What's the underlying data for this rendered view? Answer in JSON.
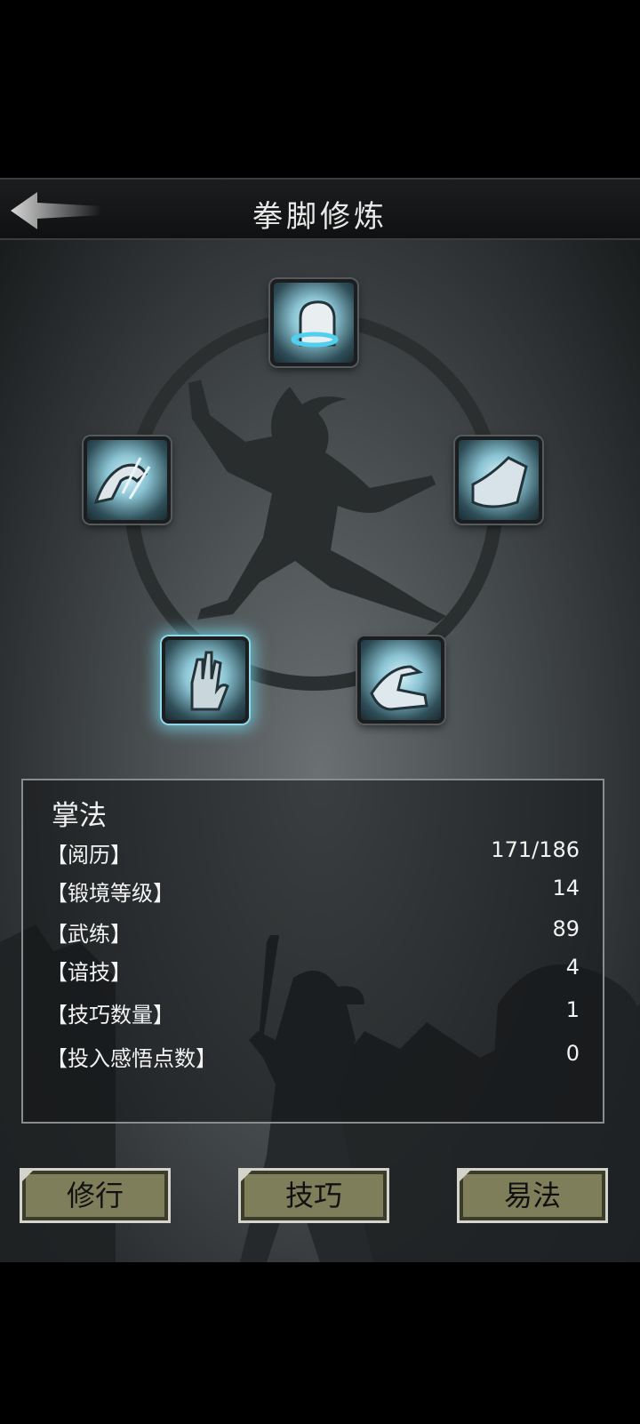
{
  "header": {
    "title": "拳脚修炼",
    "back_icon": "back-arrow-icon"
  },
  "skills": [
    {
      "name": "fist-skill",
      "icon": "fist-icon",
      "selected": false
    },
    {
      "name": "claw-skill",
      "icon": "claw-icon",
      "selected": false
    },
    {
      "name": "kick-skill",
      "icon": "kick-icon",
      "selected": false
    },
    {
      "name": "palm-skill",
      "icon": "palm-icon",
      "selected": true
    },
    {
      "name": "finger-skill",
      "icon": "finger-icon",
      "selected": false
    }
  ],
  "panel": {
    "title": "掌法",
    "stats": [
      {
        "label": "【阅历】",
        "value": "171/186"
      },
      {
        "label": "【锻境等级】",
        "value": "14"
      },
      {
        "label": "【武练】",
        "value": "89"
      },
      {
        "label": "【谙技】",
        "value": "4"
      },
      {
        "label": "【技巧数量】",
        "value": "1"
      },
      {
        "label": "【投入感悟点数】",
        "value": "0"
      }
    ]
  },
  "buttons": {
    "train": "修行",
    "technique": "技巧",
    "change": "易法"
  },
  "colors": {
    "button_bg": "#7f7e5a",
    "glow": "#8fd8ea",
    "background": "#000000"
  }
}
